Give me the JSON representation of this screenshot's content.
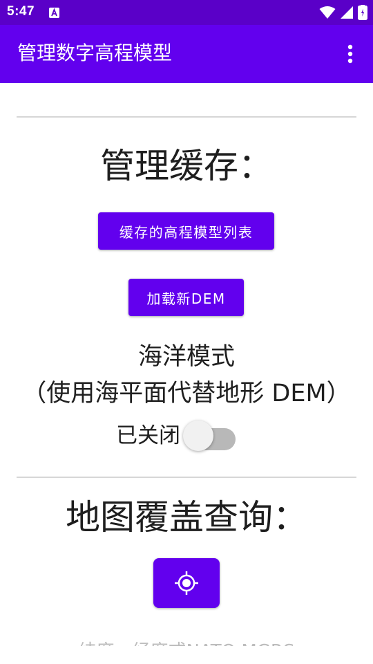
{
  "status_bar": {
    "time": "5:47",
    "icons": [
      "a-notification-icon",
      "wifi-icon",
      "signal-icon",
      "battery-icon"
    ]
  },
  "app_bar": {
    "title": "管理数字高程模型",
    "menu_icon": "overflow-menu-icon"
  },
  "cache_section": {
    "heading": "管理缓存：",
    "list_button_label": "缓存的高程模型列表",
    "load_button_label": "加载新DEM"
  },
  "ocean_mode": {
    "title": "海洋模式",
    "subtitle": "（使用海平面代替地形 DEM）",
    "switch_label": "已关闭",
    "switch_on": false
  },
  "overlay_section": {
    "heading": "地图覆盖查询：",
    "locate_icon": "gps-target-icon",
    "coordinate_placeholder": "纬度，经度或NATO MGRS"
  },
  "colors": {
    "status_bar": "#5a00c8",
    "app_bar": "#6200ee",
    "primary": "#6200ee"
  }
}
